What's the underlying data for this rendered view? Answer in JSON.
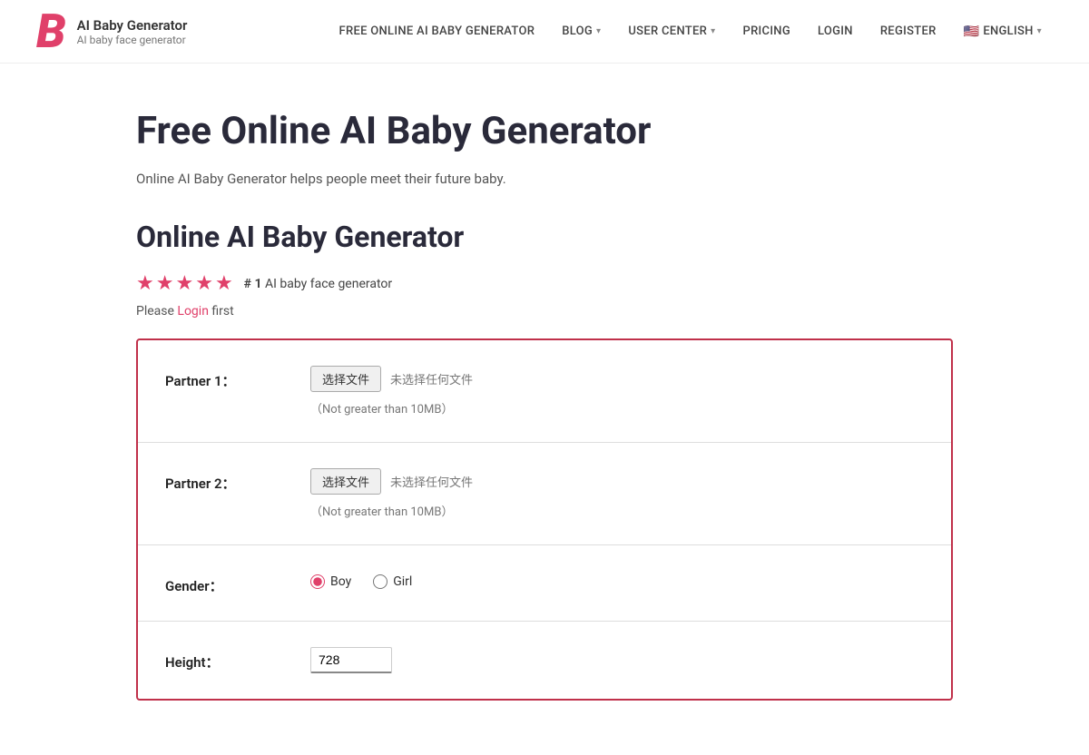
{
  "brand": {
    "logo": "B",
    "title": "AI Baby Generator",
    "subtitle": "AI baby face generator"
  },
  "navbar": {
    "items": [
      {
        "label": "FREE ONLINE AI BABY GENERATOR",
        "has_dropdown": false
      },
      {
        "label": "BLOG",
        "has_dropdown": true
      },
      {
        "label": "USER CENTER",
        "has_dropdown": true
      },
      {
        "label": "PRICING",
        "has_dropdown": false
      },
      {
        "label": "LOGIN",
        "has_dropdown": false
      },
      {
        "label": "REGISTER",
        "has_dropdown": false
      },
      {
        "label": "ENGLISH",
        "has_dropdown": true,
        "flag": "🇺🇸"
      }
    ]
  },
  "main": {
    "page_title": "Free Online AI Baby Generator",
    "page_subtitle": "Online AI Baby Generator helps people meet their future baby.",
    "section_title": "Online AI Baby Generator",
    "stars": [
      "★",
      "★",
      "★",
      "★",
      "★"
    ],
    "rank_label": "# 1",
    "rank_text": "AI baby face generator",
    "login_notice_prefix": "Please ",
    "login_link": "Login",
    "login_notice_suffix": " first"
  },
  "form": {
    "partner1": {
      "label": "Partner 1：",
      "btn": "选择文件",
      "no_file": "未选择任何文件",
      "hint": "（Not greater than 10MB）"
    },
    "partner2": {
      "label": "Partner 2：",
      "btn": "选择文件",
      "no_file": "未选择任何文件",
      "hint": "（Not greater than 10MB）"
    },
    "gender": {
      "label": "Gender：",
      "options": [
        "Boy",
        "Girl"
      ],
      "selected": "Boy"
    },
    "height": {
      "label": "Height：",
      "value": "728"
    }
  }
}
